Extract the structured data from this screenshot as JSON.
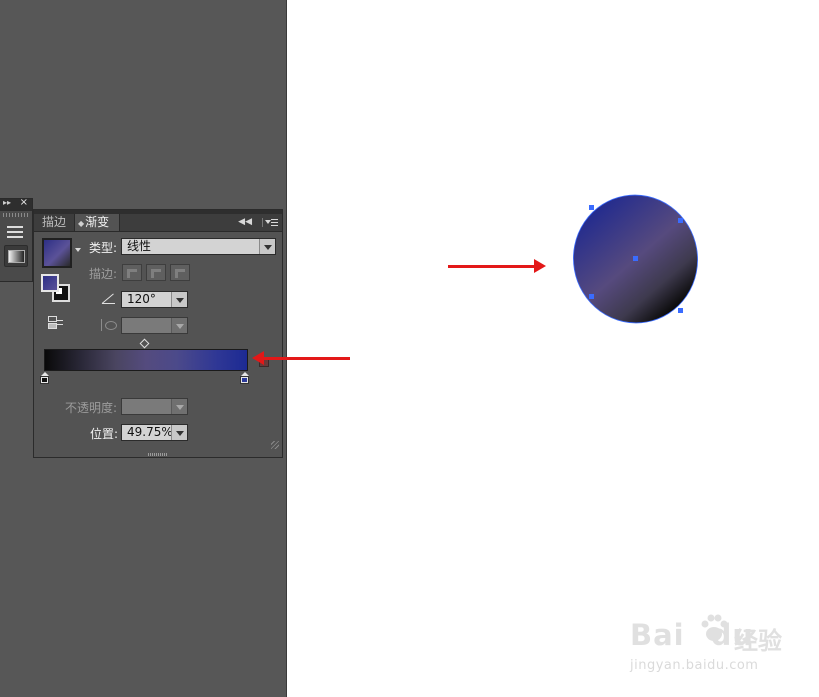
{
  "app": {
    "colors": {
      "workspace": "#575757",
      "panel": "#535353",
      "canvas": "#ffffff",
      "annotation_arrow": "#e31818",
      "gradient_end": "#1c2a93",
      "gradient_start": "#0a0a0a",
      "selection_anchor": "#3a6cff"
    }
  },
  "tool_strip": {
    "icons": [
      "expand-icon",
      "close-icon",
      "panel-menu-icon",
      "gradient-tool-icon"
    ]
  },
  "panel": {
    "tabs": [
      {
        "label": "描边",
        "active": false
      },
      {
        "label": "渐变",
        "active": true
      }
    ],
    "type_label": "类型:",
    "type_value": "线性",
    "stroke_label": "描边:",
    "angle_value": "120°",
    "aspect_value": "",
    "opacity_label": "不透明度:",
    "opacity_value": "",
    "location_label": "位置:",
    "location_value": "49.75%"
  },
  "watermark": {
    "brand": "Bai",
    "brand_tail": "du",
    "cn": "经验",
    "url": "jingyan.baidu.com"
  }
}
